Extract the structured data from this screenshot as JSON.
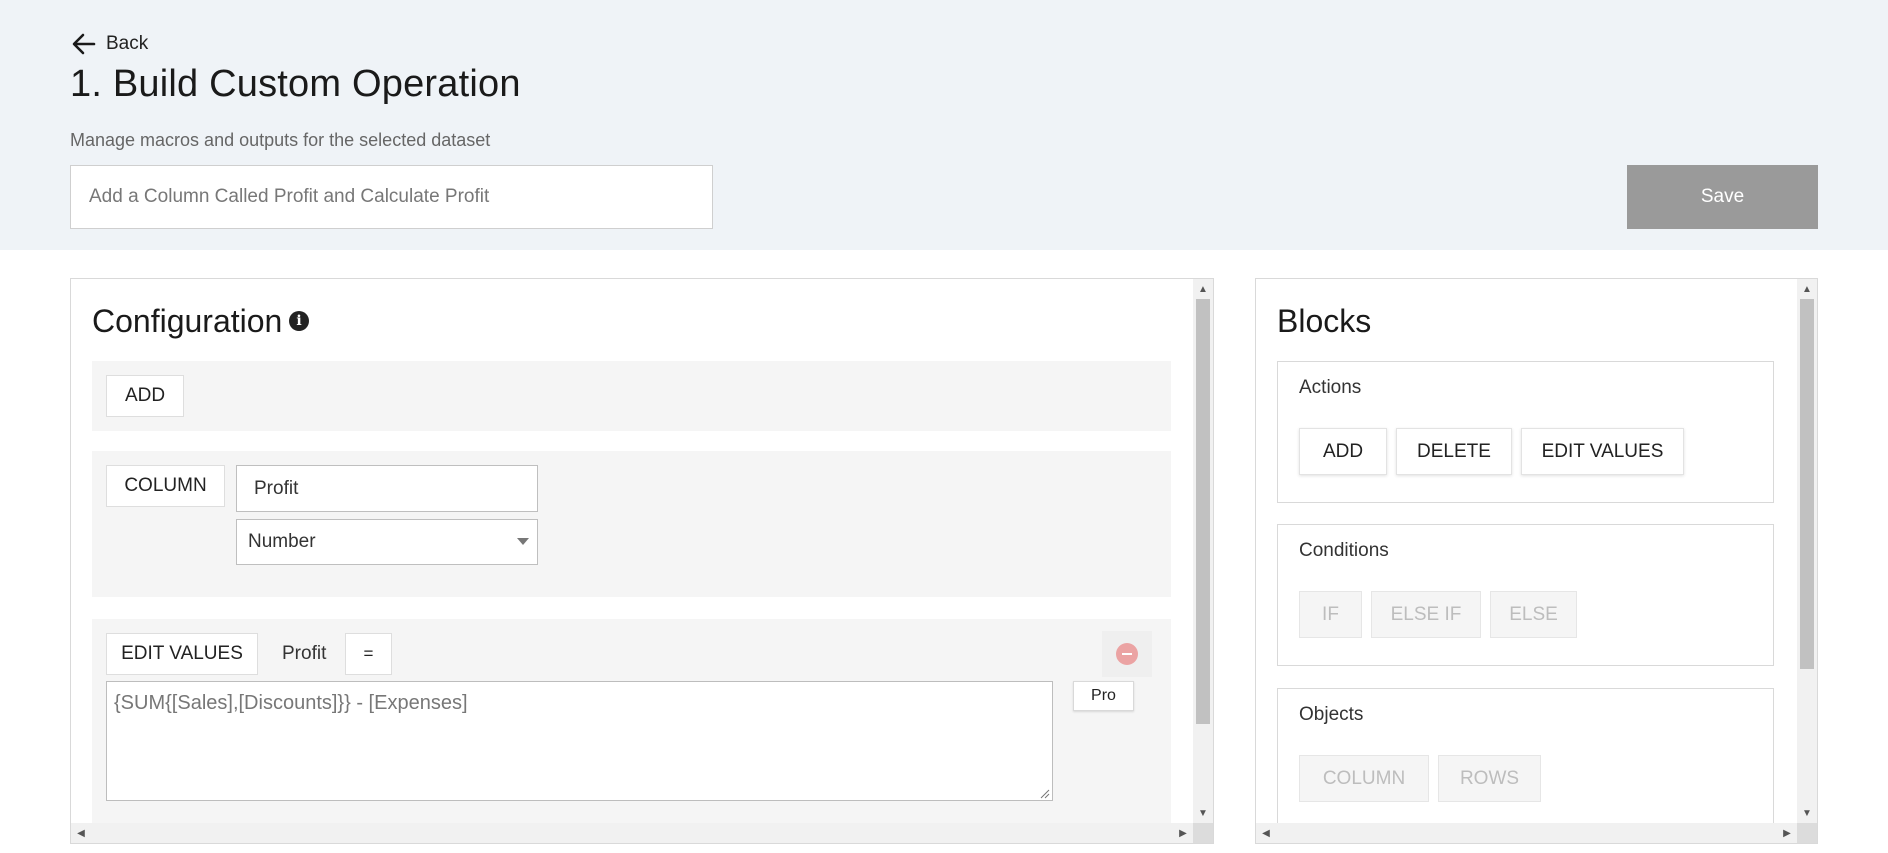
{
  "header": {
    "back_label": "Back",
    "title": "1. Build Custom Operation",
    "subtitle": "Manage macros and outputs for the selected dataset",
    "name_placeholder": "Add a Column Called Profit and Calculate Profit",
    "save_label": "Save"
  },
  "configuration": {
    "title": "Configuration",
    "add_row": {
      "chip_label": "ADD"
    },
    "column_row": {
      "chip_label": "COLUMN",
      "name_value": "Profit",
      "type_value": "Number"
    },
    "edit_row": {
      "chip_label": "EDIT VALUES",
      "target_label": "Profit",
      "operator_label": "=",
      "formula_value": "{SUM{[Sales],[Discounts]}} - [Expenses]",
      "suggestion_label": "Pro"
    }
  },
  "blocks": {
    "title": "Blocks",
    "actions": {
      "title": "Actions",
      "items": [
        "ADD",
        "DELETE",
        "EDIT VALUES"
      ]
    },
    "conditions": {
      "title": "Conditions",
      "items": [
        "IF",
        "ELSE IF",
        "ELSE"
      ]
    },
    "objects": {
      "title": "Objects",
      "items": [
        "COLUMN",
        "ROWS"
      ]
    }
  },
  "colors": {
    "header_background": "#eff3f7",
    "save_button": "#9a9a9a",
    "remove_icon": "#eba3a3"
  },
  "icons": [
    "back-arrow-icon",
    "info-icon",
    "remove-circle-icon"
  ]
}
